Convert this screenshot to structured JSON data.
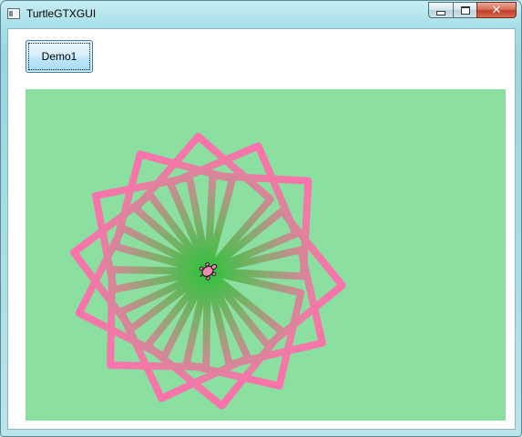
{
  "window": {
    "title": "TurtleGTXGUI",
    "icon": "window-app-icon",
    "caption": {
      "minimize_icon": "minimize-icon",
      "maximize_icon": "maximize-icon",
      "close_icon": "close-icon",
      "close_glyph": "✕"
    }
  },
  "toolbar": {
    "demo1_label": "Demo1"
  },
  "canvas": {
    "background": "#8bdfa1",
    "turtle_icon": "turtle-icon",
    "drawing": {
      "shape": "square",
      "squares": 13,
      "rotation_step_deg": 26,
      "line_color_outer": "#ff6fae",
      "line_color_center": "#2fc13c",
      "line_width": 8
    }
  }
}
